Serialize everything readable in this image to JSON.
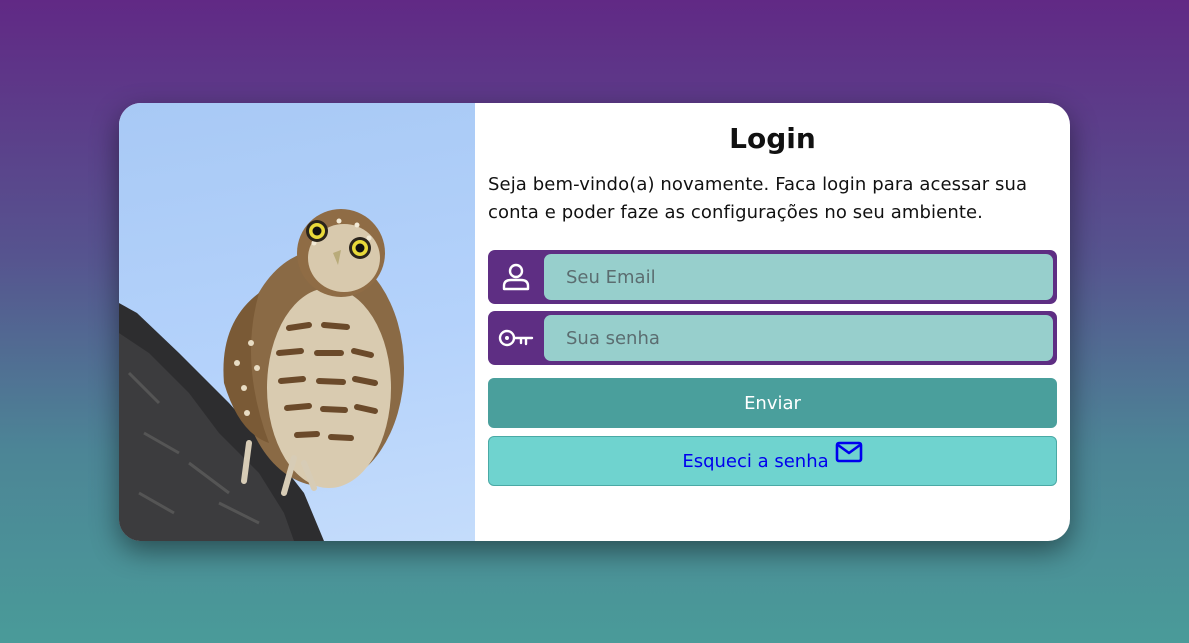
{
  "login": {
    "title": "Login",
    "welcome_text": "Seja bem-vindo(a) novamente. Faca login para acessar sua conta e poder faze as configurações no seu ambiente.",
    "email_placeholder": "Seu Email",
    "password_placeholder": "Sua senha",
    "submit_label": "Enviar",
    "forgot_label": "Esqueci a senha"
  },
  "icons": {
    "email_field": "user-icon",
    "password_field": "key-icon",
    "forgot": "mail-icon"
  },
  "colors": {
    "field_frame": "#5e2e83",
    "input_fill": "#97cfcc",
    "submit_button": "#4a9f9c",
    "forgot_button": "#6fd3cf",
    "forgot_text": "#0000ee"
  }
}
